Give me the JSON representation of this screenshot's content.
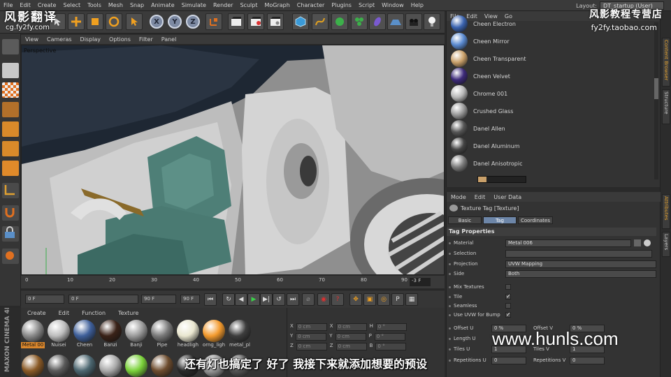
{
  "menubar": {
    "items": [
      "File",
      "Edit",
      "Create",
      "Select",
      "Tools",
      "Mesh",
      "Snap",
      "Animate",
      "Simulate",
      "Render",
      "Sculpt",
      "MoGraph",
      "Character",
      "Plugins",
      "Script",
      "Window",
      "Help"
    ],
    "layout_label": "Layout:",
    "layout_value": "DT_startup (User)"
  },
  "toolbar": {
    "axis_x": "X",
    "axis_y": "Y",
    "axis_z": "Z"
  },
  "viewport": {
    "menu": [
      "View",
      "Cameras",
      "Display",
      "Options",
      "Filter",
      "Panel"
    ],
    "label": "Perspective"
  },
  "timeline": {
    "ticks": [
      "0",
      "10",
      "20",
      "30",
      "40",
      "50",
      "60",
      "70",
      "80",
      "90"
    ],
    "current": "-3 F"
  },
  "transport": {
    "start": "0 F",
    "min": "0 F",
    "max": "90 F",
    "end": "90 F"
  },
  "material_manager": {
    "menu": [
      "Create",
      "Edit",
      "Function",
      "Texture"
    ],
    "brand_line1": "MAXON",
    "brand_line2": "CINEMA 4D",
    "materials": [
      {
        "name": "Metal 00",
        "color": "#8a8a8a",
        "selected": true
      },
      {
        "name": "Nuisei",
        "color": "#bdbdbd",
        "selected": false
      },
      {
        "name": "Cheen",
        "color": "#3e5f9a",
        "selected": false
      },
      {
        "name": "Banzi",
        "color": "#3a2218",
        "selected": false
      },
      {
        "name": "Banji",
        "color": "#9b9b9b",
        "selected": false
      },
      {
        "name": "Pipe",
        "color": "#7a7a7a",
        "selected": false
      },
      {
        "name": "headligh",
        "color": "#e9e6cf",
        "selected": false
      },
      {
        "name": "orng_ligh",
        "color": "#f39a2d",
        "selected": false
      },
      {
        "name": "metal_pl",
        "color": "#3d3d3d",
        "selected": false
      }
    ],
    "row2_colors": [
      "#8a5a26",
      "#5a5a5a",
      "#4c6670",
      "#aaaaaa",
      "#7bd23a",
      "#6d4c2e",
      "#2a2a2a",
      "#9a9a9a",
      "#555555"
    ]
  },
  "coords": {
    "rows": [
      {
        "a": "X",
        "av": "0 cm",
        "b": "X",
        "bv": "0 cm",
        "c": "H",
        "cv": "0 °"
      },
      {
        "a": "Y",
        "av": "0 cm",
        "b": "Y",
        "bv": "0 cm",
        "c": "P",
        "cv": "0 °"
      },
      {
        "a": "Z",
        "av": "0 cm",
        "b": "Z",
        "bv": "0 cm",
        "c": "B",
        "cv": "0 °"
      }
    ]
  },
  "object_panel": {
    "menu": [
      "File",
      "Edit",
      "View",
      "Go"
    ],
    "items": [
      {
        "label": "Cheen Electron",
        "color": "#3a63b0"
      },
      {
        "label": "Cheen Mirror",
        "color": "#5a8ad0"
      },
      {
        "label": "Cheen Transparent",
        "color": "#c9a06a"
      },
      {
        "label": "Cheen Velvet",
        "color": "#3d2a7a"
      },
      {
        "label": "Chrome 001",
        "color": "#b8b8b8"
      },
      {
        "label": "Crushed Glass",
        "color": "#9a9a9a"
      },
      {
        "label": "Danel Allen",
        "color": "#555555"
      },
      {
        "label": "Danel Aluminum",
        "color": "#444444"
      },
      {
        "label": "Danel Anisotropic",
        "color": "#7d7d7d"
      }
    ]
  },
  "side_tabs": [
    "Content Browser",
    "Structure",
    "Attributes",
    "Layers"
  ],
  "attributes": {
    "menu": [
      "Mode",
      "Edit",
      "User Data"
    ],
    "title": "Texture Tag [Texture]",
    "tabs": [
      "Basic",
      "Tag",
      "Coordinates"
    ],
    "active_tab": "Tag",
    "section": "Tag Properties",
    "material_label": "Material",
    "material_value": "Metal 006",
    "selection_label": "Selection",
    "projection_label": "Projection",
    "projection_value": "UVW Mapping",
    "side_label": "Side",
    "side_value": "Both",
    "mix_label": "Mix Textures",
    "tile_label": "Tile",
    "seamless_label": "Seamless",
    "uvw_label": "Use UVW for Bump",
    "offset_u_label": "Offset U",
    "offset_u_value": "0 %",
    "offset_v_label": "Offset V",
    "offset_v_value": "0 %",
    "length_u_label": "Length U",
    "tiles_u_label": "Tiles U",
    "tiles_v_label": "Tiles V",
    "tiles_u_value": "1",
    "tiles_v_value": "1",
    "repetitions_u_label": "Repetitions U",
    "repetitions_u_value": "0",
    "repetitions_v_label": "Repetitions V",
    "repetitions_v_value": "0"
  },
  "watermarks": {
    "top_left": "风影翻译",
    "top_left_sub": "cg.fy2fy.com",
    "top_right": "风影教程专营店",
    "top_right_sub": "fy2fy.taobao.com",
    "bottom_right": "www.hunls.com"
  },
  "subtitle": "还有灯也搞定了 好了 我接下来就添加想要的预设"
}
